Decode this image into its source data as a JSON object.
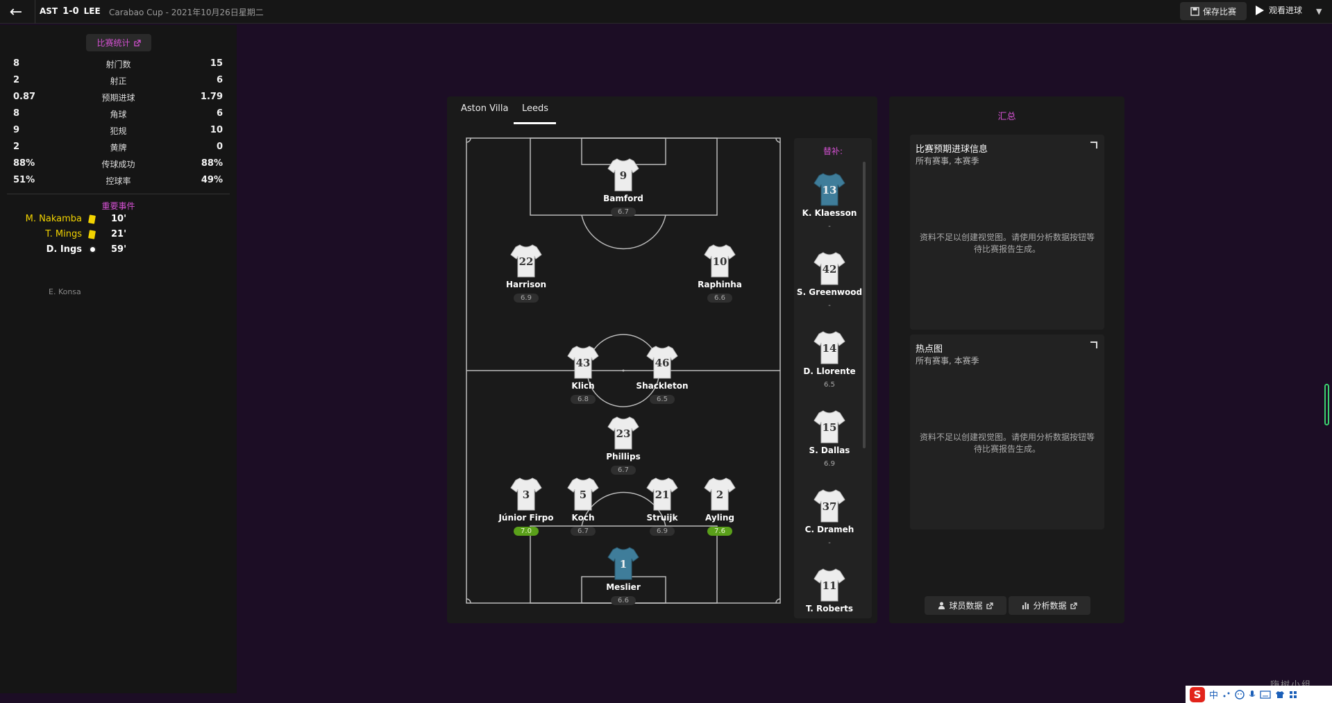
{
  "header": {
    "home": "AST",
    "score": "1-0",
    "away": "LEE",
    "competition": "Carabao Cup - 2021年10月26日星期二",
    "save_label": "保存比赛",
    "watch_label": "观看进球"
  },
  "stats_panel": {
    "title": "比赛统计",
    "rows": [
      {
        "left": "8",
        "label": "射门数",
        "right": "15"
      },
      {
        "left": "2",
        "label": "射正",
        "right": "6"
      },
      {
        "left": "0.87",
        "label": "预期进球",
        "right": "1.79"
      },
      {
        "left": "8",
        "label": "角球",
        "right": "6"
      },
      {
        "left": "9",
        "label": "犯规",
        "right": "10"
      },
      {
        "left": "2",
        "label": "黄牌",
        "right": "0"
      },
      {
        "left": "88%",
        "label": "传球成功",
        "right": "88%"
      },
      {
        "left": "51%",
        "label": "控球率",
        "right": "49%"
      }
    ],
    "events_title": "重要事件",
    "events": [
      {
        "player": "M. Nakamba",
        "type": "yellow-card",
        "minute": "10'",
        "color": "#f2d300"
      },
      {
        "player": "T. Mings",
        "type": "yellow-card",
        "minute": "21'",
        "color": "#f2d300"
      },
      {
        "player": "D. Ings",
        "type": "goal",
        "minute": "59'",
        "color": "#ffffff"
      }
    ],
    "assist": "E. Konsa"
  },
  "lineup": {
    "tabs": [
      "Aston Villa",
      "Leeds"
    ],
    "active_tab": "Leeds",
    "players": [
      {
        "number": "9",
        "name": "Bamford",
        "rating": "6.7",
        "kit": "outfield",
        "good": false
      },
      {
        "number": "22",
        "name": "Harrison",
        "rating": "6.9",
        "kit": "outfield",
        "good": false
      },
      {
        "number": "10",
        "name": "Raphinha",
        "rating": "6.6",
        "kit": "outfield",
        "good": false
      },
      {
        "number": "43",
        "name": "Klich",
        "rating": "6.8",
        "kit": "outfield",
        "good": false
      },
      {
        "number": "46",
        "name": "Shackleton",
        "rating": "6.5",
        "kit": "outfield",
        "good": false
      },
      {
        "number": "23",
        "name": "Phillips",
        "rating": "6.7",
        "kit": "outfield",
        "good": false
      },
      {
        "number": "3",
        "name": "Júnior Firpo",
        "rating": "7.0",
        "kit": "outfield",
        "good": true
      },
      {
        "number": "5",
        "name": "Koch",
        "rating": "6.7",
        "kit": "outfield",
        "good": false
      },
      {
        "number": "21",
        "name": "Struijk",
        "rating": "6.9",
        "kit": "outfield",
        "good": false
      },
      {
        "number": "2",
        "name": "Ayling",
        "rating": "7.6",
        "kit": "outfield",
        "good": true
      },
      {
        "number": "1",
        "name": "Meslier",
        "rating": "6.6",
        "kit": "goalkeeper",
        "good": false
      }
    ],
    "subs_title": "替补:",
    "subs": [
      {
        "number": "13",
        "name": "K. Klaesson",
        "rating": "-",
        "kit": "goalkeeper"
      },
      {
        "number": "42",
        "name": "S. Greenwood",
        "rating": "-",
        "kit": "outfield"
      },
      {
        "number": "14",
        "name": "D. Llorente",
        "rating": "6.5",
        "kit": "outfield"
      },
      {
        "number": "15",
        "name": "S. Dallas",
        "rating": "6.9",
        "kit": "outfield"
      },
      {
        "number": "37",
        "name": "C. Drameh",
        "rating": "-",
        "kit": "outfield"
      },
      {
        "number": "11",
        "name": "T. Roberts",
        "rating": "",
        "kit": "outfield"
      }
    ]
  },
  "summary": {
    "title": "汇总",
    "cards": [
      {
        "title": "比赛预期进球信息",
        "subtitle": "所有赛事, 本赛季",
        "message": "资料不足以创建视觉图。请使用分析数据按钮等待比赛报告生成。"
      },
      {
        "title": "热点图",
        "subtitle": "所有赛事, 本赛季",
        "message": "资料不足以创建视觉图。请使用分析数据按钮等待比赛报告生成。"
      }
    ],
    "player_data_label": "球员数据",
    "analysis_label": "分析数据"
  },
  "taskbar": {
    "ime": "中"
  },
  "watermark": "嗨树小组",
  "colors": {
    "accent": "#d451d2",
    "good_rating": "#5aa01a",
    "background": "#1c0d25"
  }
}
